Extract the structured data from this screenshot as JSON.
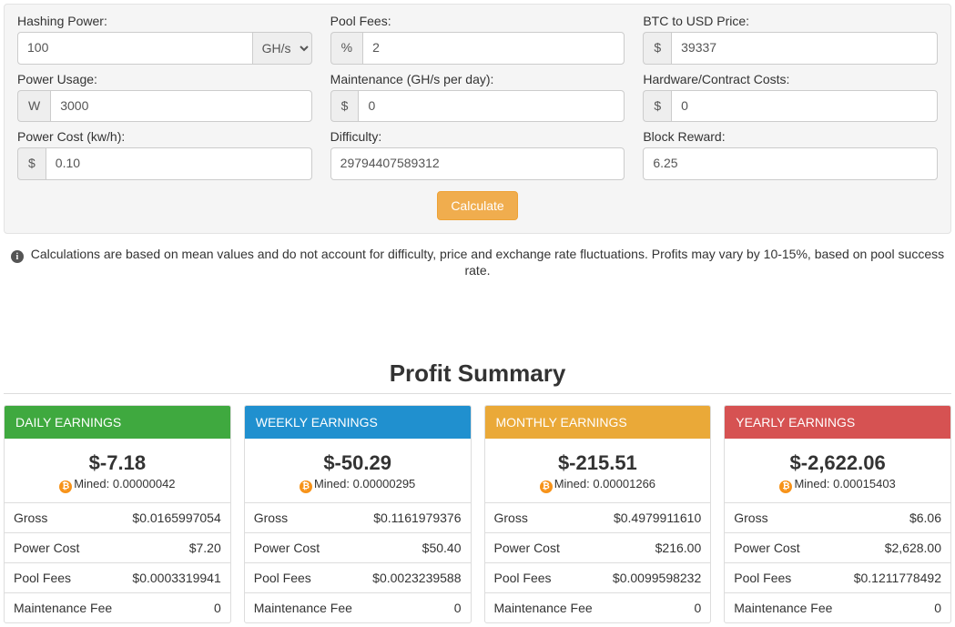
{
  "form": {
    "hashingPower": {
      "label": "Hashing Power:",
      "value": "100",
      "unit_selected": "GH/s",
      "unit_options": [
        "GH/s"
      ]
    },
    "poolFees": {
      "label": "Pool Fees:",
      "prefix": "%",
      "value": "2"
    },
    "btcPrice": {
      "label": "BTC to USD Price:",
      "prefix": "$",
      "value": "39337"
    },
    "powerUsage": {
      "label": "Power Usage:",
      "prefix": "W",
      "value": "3000"
    },
    "maintenance": {
      "label": "Maintenance (GH/s per day):",
      "prefix": "$",
      "value": "0"
    },
    "hardwareCost": {
      "label": "Hardware/Contract Costs:",
      "prefix": "$",
      "value": "0"
    },
    "powerCost": {
      "label": "Power Cost (kw/h):",
      "prefix": "$",
      "value": "0.10"
    },
    "difficulty": {
      "label": "Difficulty:",
      "value": "29794407589312"
    },
    "blockReward": {
      "label": "Block Reward:",
      "value": "6.25"
    },
    "calculate_label": "Calculate"
  },
  "note": "Calculations are based on mean values and do not account for difficulty, price and exchange rate fluctuations. Profits may vary by 10-15%, based on pool success rate.",
  "summaryTitle": "Profit Summary",
  "row_labels": {
    "mined_prefix": "Mined: ",
    "gross": "Gross",
    "power": "Power Cost",
    "pool": "Pool Fees",
    "maint": "Maintenance Fee"
  },
  "cards": {
    "daily": {
      "title": "DAILY EARNINGS",
      "earn": "$-7.18",
      "mined": "0.00000042",
      "gross": "$0.0165997054",
      "power": "$7.20",
      "pool": "$0.0003319941",
      "maint": "0"
    },
    "weekly": {
      "title": "WEEKLY EARNINGS",
      "earn": "$-50.29",
      "mined": "0.00000295",
      "gross": "$0.1161979376",
      "power": "$50.40",
      "pool": "$0.0023239588",
      "maint": "0"
    },
    "monthly": {
      "title": "MONTHLY EARNINGS",
      "earn": "$-215.51",
      "mined": "0.00001266",
      "gross": "$0.4979911610",
      "power": "$216.00",
      "pool": "$0.0099598232",
      "maint": "0"
    },
    "yearly": {
      "title": "YEARLY EARNINGS",
      "earn": "$-2,622.06",
      "mined": "0.00015403",
      "gross": "$6.06",
      "power": "$2,628.00",
      "pool": "$0.1211778492",
      "maint": "0"
    }
  }
}
